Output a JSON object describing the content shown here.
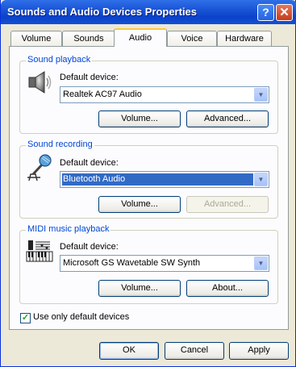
{
  "window": {
    "title": "Sounds and Audio Devices Properties",
    "help_glyph": "?",
    "close_glyph": "✕"
  },
  "tabs": [
    {
      "label": "Volume"
    },
    {
      "label": "Sounds"
    },
    {
      "label": "Audio"
    },
    {
      "label": "Voice"
    },
    {
      "label": "Hardware"
    }
  ],
  "playback": {
    "title": "Sound playback",
    "label": "Default device:",
    "device": "Realtek AC97 Audio",
    "volume_button": "Volume...",
    "advanced_button": "Advanced..."
  },
  "recording": {
    "title": "Sound recording",
    "label": "Default device:",
    "device": "Bluetooth Audio",
    "volume_button": "Volume...",
    "advanced_button": "Advanced..."
  },
  "midi": {
    "title": "MIDI music playback",
    "label": "Default device:",
    "device": "Microsoft GS Wavetable SW Synth",
    "volume_button": "Volume...",
    "about_button": "About..."
  },
  "checkbox": {
    "label": "Use only default devices",
    "checked": true
  },
  "footer": {
    "ok": "OK",
    "cancel": "Cancel",
    "apply": "Apply"
  },
  "colors": {
    "titlebar": "#0a42c8",
    "group_title": "#0046d5",
    "selection": "#316ac5",
    "face": "#ece9d8"
  }
}
